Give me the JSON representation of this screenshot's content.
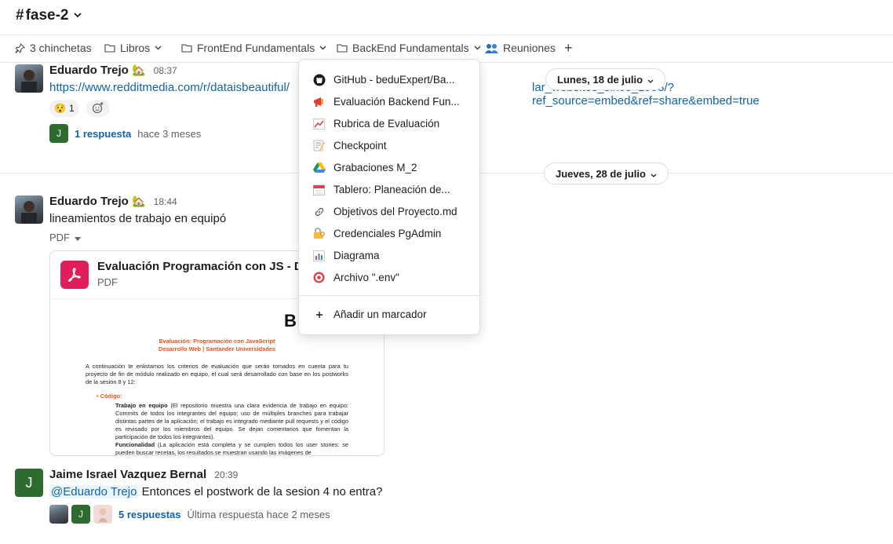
{
  "channel": {
    "name": "fase-2",
    "hash": "#"
  },
  "bookmarks": {
    "pins": "3 chinchetas",
    "folders": [
      "Libros",
      "FrontEnd Fundamentals",
      "BackEnd Fundamentals"
    ],
    "meetings": "Reuniones",
    "add": "+"
  },
  "dropdown": {
    "items": [
      {
        "label": "GitHub - beduExpert/Ba...",
        "icon": "github-icon"
      },
      {
        "label": "Evaluación Backend Fun...",
        "icon": "megaphone-icon"
      },
      {
        "label": "Rubrica de Evaluación",
        "icon": "chart-increasing-icon"
      },
      {
        "label": "Checkpoint",
        "icon": "memo-icon"
      },
      {
        "label": "Grabaciones M_2",
        "icon": "google-drive-icon"
      },
      {
        "label": "Tablero: Planeación de...",
        "icon": "calendar-icon"
      },
      {
        "label": "Objetivos del Proyecto.md",
        "icon": "link-icon"
      },
      {
        "label": "Credenciales PgAdmin",
        "icon": "locked-with-key-icon"
      },
      {
        "label": "Diagrama",
        "icon": "bar-chart-icon"
      },
      {
        "label": "Archivo \".env\"",
        "icon": "target-icon"
      }
    ],
    "add_bookmark": "Añadir un marcador"
  },
  "dates": {
    "first": "Lunes, 18 de julio",
    "second": "Jueves, 28 de julio"
  },
  "messages": [
    {
      "author": "Eduardo Trejo",
      "status_emoji": "🏡",
      "time": "08:37",
      "link_start": "https://www.redditmedia.com/r/dataisbeautiful/",
      "link_end": "lar_websites_since_1993/?ref_source=embed&ref=share&embed=true",
      "reaction_emoji": "😯",
      "reaction_count": "1",
      "reply_avatar": "J",
      "replies": "1 respuesta",
      "replies_when": "hace 3 meses"
    },
    {
      "author": "Eduardo Trejo",
      "status_emoji": "🏡",
      "time": "18:44",
      "text": "lineamientos de trabajo en equipó",
      "file_type_label": "PDF",
      "file": {
        "name": "Evaluación Programación con JS - DW...",
        "type": "PDF",
        "preview": {
          "logo": "B",
          "title1": "Evaluación: Programación con JavaScript",
          "title2": "Desarrollo Web | Santander Universidades",
          "intro": "A continuación te enlistamos los criterios de evaluación que serán tomados en cuenta para tu proyecto de fin de módulo realizado en equipo, el cual será desarrollado con base en los postworks de la sesión 8 y 12:",
          "bullet": "Código:",
          "item1_title": "Trabajo en equipo",
          "item1_text": "(El repositorio muestra una clara evidencia de trabajo en equipo: Commits de todos los integrantes del equipo; uso de múltiples branches para trabajar distintas partes de la aplicación; el trabajo es integrado mediante pull requests y el código es revisado por los miembros del equipo. Se dejan comentarios que fomentan la participación de todos los integrantes).",
          "item2_title": "Funcionalidad",
          "item2_text": "(La aplicación está completa y se cumplen todos los user stories: se pueden buscar recetas, los resultados se muestran usando las imágenes de"
        }
      }
    },
    {
      "author": "Jaime Israel Vazquez Bernal",
      "avatar_letter": "J",
      "time": "20:39",
      "mention": "@Eduardo Trejo",
      "text": "Entonces el postwork de la sesion 4 no entra?",
      "replies": "5 respuestas",
      "replies_when": "Última respuesta hace 2 meses"
    }
  ],
  "colors": {
    "link": "#1264a3",
    "pdf_red": "#e01e5a",
    "avatar_green": "#2e6b2e",
    "doc_orange": "#e8531c"
  }
}
